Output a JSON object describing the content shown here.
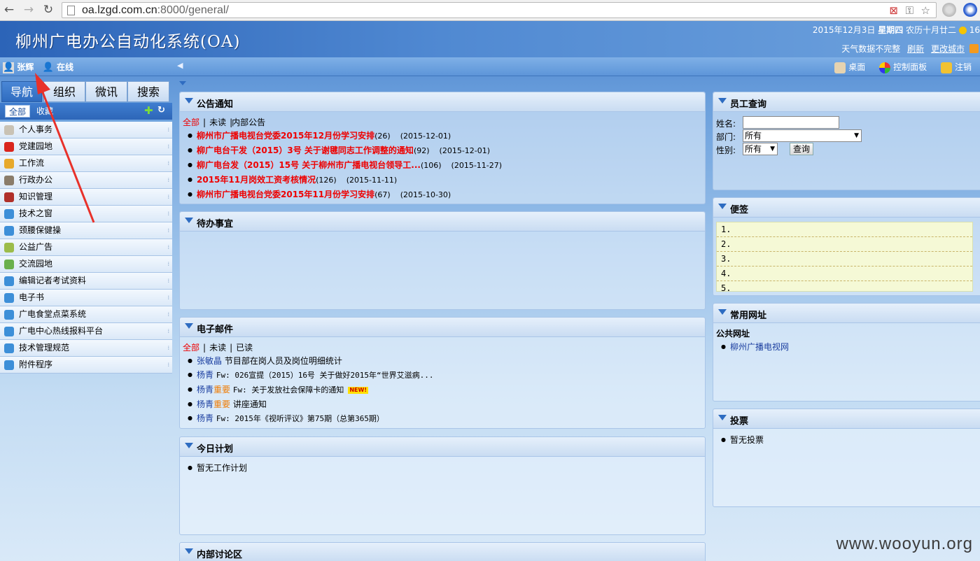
{
  "browser": {
    "url_host": "oa.lzgd.com.cn",
    "url_rest": ":8000/general/"
  },
  "header": {
    "title": "柳州广电办公自动化系统(OA)",
    "date": "2015年12月3日",
    "weekday": "星期四",
    "lunar": "农历十月廿二",
    "clock_partial": "16",
    "weather_text": "天气数据不完整",
    "refresh": "刷新",
    "change_city": "更改城市"
  },
  "statusbar": {
    "user_name": "张辉",
    "online": "在线",
    "desktop": "桌面",
    "control_panel": "控制面板",
    "logout": "注销"
  },
  "nav": {
    "tabs": [
      "导航",
      "组织",
      "微讯",
      "搜索"
    ],
    "subtabs": [
      "全部",
      "收藏"
    ],
    "menu": [
      "个人事务",
      "党建园地",
      "工作流",
      "行政办公",
      "知识管理",
      "技术之窗",
      "颈腰保健操",
      "公益广告",
      "交流园地",
      "编辑记者考试资料",
      "电子书",
      "广电食堂点菜系统",
      "广电中心热线报料平台",
      "技术管理规范",
      "附件程序"
    ]
  },
  "notice": {
    "title": "公告通知",
    "filters": [
      "全部",
      "未读",
      "内部公告"
    ],
    "items": [
      {
        "title": "柳州市广播电视台党委2015年12月份学习安排",
        "count": "(26)",
        "date": "(2015-12-01)"
      },
      {
        "title": "柳广电台干发（2015）3号 关于谢毽同志工作调整的通知",
        "count": "(92)",
        "date": "(2015-12-01)"
      },
      {
        "title": "柳广电台发（2015）15号 关于柳州市广播电视台领导工...",
        "count": "(106)",
        "date": "(2015-11-27)"
      },
      {
        "title": "2015年11月岗效工资考核情况",
        "count": "(126)",
        "date": "(2015-11-11)"
      },
      {
        "title": "柳州市广播电视台党委2015年11月份学习安排",
        "count": "(67)",
        "date": "(2015-10-30)"
      }
    ]
  },
  "todo": {
    "title": "待办事宜"
  },
  "email": {
    "title": "电子邮件",
    "filters": [
      "全部",
      "未读",
      "已读"
    ],
    "items": [
      {
        "sender": "张敏晶",
        "important": "",
        "subject": "节目部在岗人员及岗位明细统计",
        "new": ""
      },
      {
        "sender": "杨青",
        "important": "",
        "subject": "Fw: 026宣提（2015）16号 关于做好2015年“世界艾滋病...",
        "new": ""
      },
      {
        "sender": "杨青",
        "important": "重要",
        "subject": "Fw: 关于发放社会保障卡的通知",
        "new": "NEW!"
      },
      {
        "sender": "杨青",
        "important": "重要",
        "subject": "讲座通知",
        "new": ""
      },
      {
        "sender": "杨青",
        "important": "",
        "subject": "Fw: 2015年《视听评议》第75期（总第365期）",
        "new": ""
      }
    ]
  },
  "plan": {
    "title": "今日计划",
    "empty": "暂无工作计划"
  },
  "forum": {
    "title": "内部讨论区"
  },
  "staff": {
    "title": "员工查询",
    "name_label": "姓名:",
    "dept_label": "部门:",
    "dept_value": "所有",
    "gender_label": "性别:",
    "gender_value": "所有",
    "query_button": "查询"
  },
  "notes": {
    "title": "便签",
    "lines": [
      "1.",
      "2.",
      "3.",
      "4.",
      "5."
    ]
  },
  "links": {
    "title": "常用网址",
    "group": "公共网址",
    "items": [
      "柳州广播电视网"
    ]
  },
  "vote": {
    "title": "投票",
    "empty": "暂无投票"
  },
  "watermark": "www.wooyun.org",
  "colors": {
    "accent": "#2e6cc1",
    "notice_red": "#e00000",
    "important_orange": "#f07a00",
    "arrow_red": "#e8312a"
  }
}
